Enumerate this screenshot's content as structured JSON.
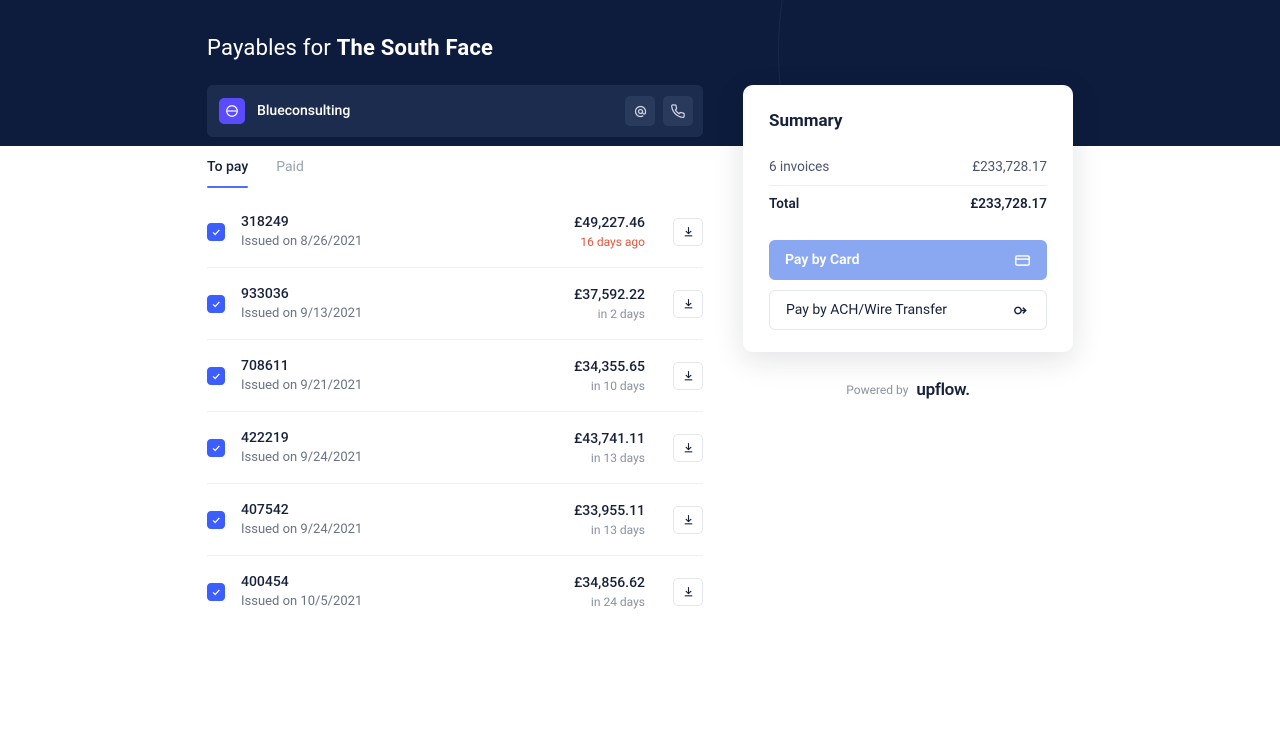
{
  "page": {
    "title_prefix": "Payables for ",
    "title_company": "The South Face"
  },
  "vendor": {
    "name": "Blueconsulting"
  },
  "tabs": {
    "to_pay": "To pay",
    "paid": "Paid"
  },
  "invoices": [
    {
      "number": "318249",
      "issued": "Issued on 8/26/2021",
      "amount": "£49,227.46",
      "due": "16 days ago",
      "overdue": true
    },
    {
      "number": "933036",
      "issued": "Issued on 9/13/2021",
      "amount": "£37,592.22",
      "due": "in 2 days",
      "overdue": false
    },
    {
      "number": "708611",
      "issued": "Issued on 9/21/2021",
      "amount": "£34,355.65",
      "due": "in 10 days",
      "overdue": false
    },
    {
      "number": "422219",
      "issued": "Issued on 9/24/2021",
      "amount": "£43,741.11",
      "due": "in 13 days",
      "overdue": false
    },
    {
      "number": "407542",
      "issued": "Issued on 9/24/2021",
      "amount": "£33,955.11",
      "due": "in 13 days",
      "overdue": false
    },
    {
      "number": "400454",
      "issued": "Issued on 10/5/2021",
      "amount": "£34,856.62",
      "due": "in 24 days",
      "overdue": false
    }
  ],
  "summary": {
    "title": "Summary",
    "count_label": "6 invoices",
    "count_amount": "£233,728.17",
    "total_label": "Total",
    "total_amount": "£233,728.17",
    "pay_card": "Pay by Card",
    "pay_wire": "Pay by ACH/Wire Transfer"
  },
  "footer": {
    "powered_by": "Powered by",
    "brand": "upflow."
  }
}
